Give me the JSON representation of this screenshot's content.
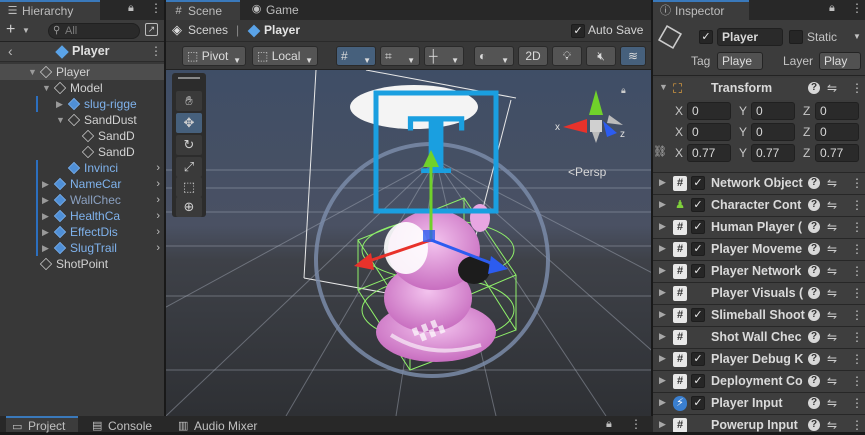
{
  "hierarchy": {
    "tab_label": "Hierarchy",
    "add_label": "+",
    "search_placeholder": "All",
    "header_title": "Player",
    "items": [
      {
        "label": "Player",
        "depth": 1,
        "expanded": true,
        "color": "normal",
        "selected": true
      },
      {
        "label": "Model",
        "depth": 2,
        "expanded": true,
        "color": "normal"
      },
      {
        "label": "slug-rigge",
        "depth": 3,
        "expanded": false,
        "color": "blue",
        "has_children": true
      },
      {
        "label": "SandDust",
        "depth": 3,
        "expanded": true,
        "color": "normal"
      },
      {
        "label": "SandD",
        "depth": 4,
        "color": "normal"
      },
      {
        "label": "SandD",
        "depth": 4,
        "color": "normal"
      },
      {
        "label": "Invinci",
        "depth": 3,
        "color": "blue",
        "has_more": true
      },
      {
        "label": "NameCar",
        "depth": 2,
        "expanded": false,
        "color": "blue",
        "has_more": true,
        "has_children": true
      },
      {
        "label": "WallChec",
        "depth": 2,
        "expanded": false,
        "color": "lightblue",
        "has_more": true,
        "has_children": true
      },
      {
        "label": "HealthCa",
        "depth": 2,
        "expanded": false,
        "color": "blue",
        "has_more": true,
        "has_children": true
      },
      {
        "label": "EffectDis",
        "depth": 2,
        "expanded": false,
        "color": "blue",
        "has_more": true,
        "has_children": true
      },
      {
        "label": "SlugTrail",
        "depth": 2,
        "expanded": false,
        "color": "blue",
        "has_more": true,
        "has_children": true
      },
      {
        "label": "ShotPoint",
        "depth": 1,
        "color": "normal"
      }
    ]
  },
  "scene": {
    "tabs": [
      {
        "label": "Scene",
        "icon": "grid-icon",
        "active": true
      },
      {
        "label": "Game",
        "icon": "gamepad-icon",
        "active": false
      }
    ],
    "breadcrumbs": {
      "scenes": "Scenes",
      "current": "Player"
    },
    "auto_save_label": "Auto Save",
    "auto_save_checked": true,
    "toolbar": {
      "pivot": "Pivot",
      "local": "Local",
      "mode_2d": "2D",
      "persp_label": "<Persp"
    },
    "axis_labels": {
      "x": "x",
      "z": "z",
      "y": "y"
    }
  },
  "inspector": {
    "tab_label": "Inspector",
    "object_name": "Player",
    "active_checked": true,
    "static_label": "Static",
    "static_checked": false,
    "tag_label": "Tag",
    "tag_value": "Playe",
    "layer_label": "Layer",
    "layer_value": "Play",
    "transform": {
      "title": "Transform",
      "position": {
        "x": "0",
        "y": "0",
        "z": "0"
      },
      "rotation": {
        "x": "0",
        "y": "0",
        "z": "0"
      },
      "scale": {
        "x": "0.77",
        "y": "0.77",
        "z": "0.77"
      },
      "x_label": "X",
      "y_label": "Y",
      "z_label": "Z"
    },
    "components": [
      {
        "name": "Network Object",
        "checkbox": true,
        "icon": "script-icon"
      },
      {
        "name": "Character Cont",
        "checkbox": true,
        "icon": "character-controller-icon"
      },
      {
        "name": "Human Player (",
        "checkbox": true,
        "icon": "script-icon"
      },
      {
        "name": "Player Moveme",
        "checkbox": true,
        "icon": "script-icon"
      },
      {
        "name": "Player Network",
        "checkbox": true,
        "icon": "script-icon"
      },
      {
        "name": "Player Visuals (",
        "checkbox": false,
        "icon": "script-icon"
      },
      {
        "name": "Slimeball Shoot",
        "checkbox": true,
        "icon": "script-icon"
      },
      {
        "name": "Shot Wall Chec",
        "checkbox": false,
        "icon": "script-icon"
      },
      {
        "name": "Player Debug K",
        "checkbox": true,
        "icon": "script-icon"
      },
      {
        "name": "Deployment Co",
        "checkbox": true,
        "icon": "script-icon"
      },
      {
        "name": "Player Input",
        "checkbox": true,
        "icon": "player-input-icon"
      },
      {
        "name": "Powerup Input",
        "checkbox": false,
        "icon": "script-icon"
      }
    ]
  },
  "bottom_tabs": [
    {
      "label": "Project",
      "icon": "folder-icon",
      "active": true
    },
    {
      "label": "Console",
      "icon": "console-icon",
      "active": false
    },
    {
      "label": "Audio Mixer",
      "icon": "audio-mixer-icon",
      "active": false
    }
  ],
  "colors": {
    "accent": "#3a79bb",
    "prefab_blue": "#7fb2ec",
    "x_axis": "#e8322b",
    "y_axis": "#70d12b",
    "z_axis": "#2c5cf0",
    "gizmo_cyan": "#1a9fe0",
    "character_pink": "#e6a0de"
  }
}
